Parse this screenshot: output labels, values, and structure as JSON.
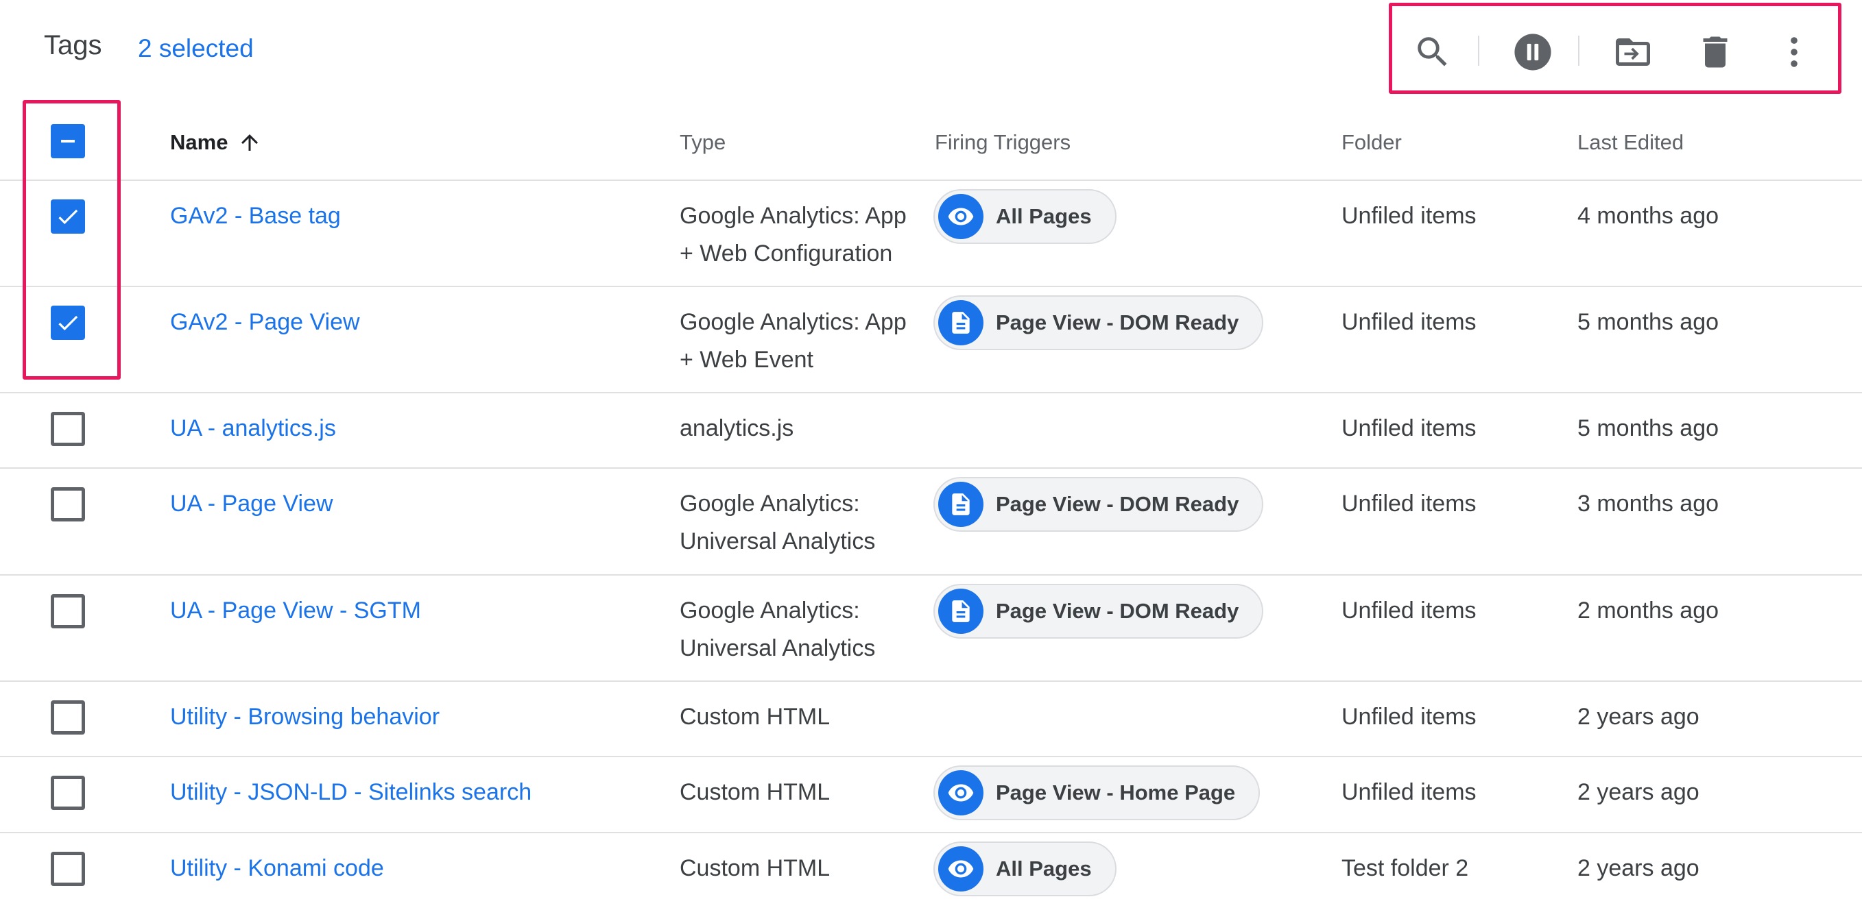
{
  "header": {
    "title": "Tags",
    "selected_label": "2 selected",
    "toolbar": [
      "search-icon",
      "pause-icon",
      "move-to-folder-icon",
      "delete-icon",
      "more-vert-icon"
    ]
  },
  "columns": {
    "name": "Name",
    "type": "Type",
    "triggers": "Firing Triggers",
    "folder": "Folder",
    "last_edited": "Last Edited"
  },
  "rows": [
    {
      "checked": true,
      "name": "GAv2 - Base tag",
      "type_line1": "Google Analytics: App",
      "type_line2": "+ Web Configuration",
      "trigger": "All Pages",
      "trigger_icon": "eye-icon",
      "folder": "Unfiled items",
      "last_edited": "4 months ago"
    },
    {
      "checked": true,
      "name": "GAv2 - Page View",
      "type_line1": "Google Analytics: App",
      "type_line2": "+ Web Event",
      "trigger": "Page View - DOM Ready",
      "trigger_icon": "document-icon",
      "folder": "Unfiled items",
      "last_edited": "5 months ago"
    },
    {
      "checked": false,
      "name": "UA - analytics.js",
      "type_line1": "analytics.js",
      "type_line2": "",
      "trigger": "",
      "trigger_icon": "",
      "folder": "Unfiled items",
      "last_edited": "5 months ago"
    },
    {
      "checked": false,
      "name": "UA - Page View",
      "type_line1": "Google Analytics:",
      "type_line2": "Universal Analytics",
      "trigger": "Page View - DOM Ready",
      "trigger_icon": "document-icon",
      "folder": "Unfiled items",
      "last_edited": "3 months ago"
    },
    {
      "checked": false,
      "name": "UA - Page View - SGTM",
      "type_line1": "Google Analytics:",
      "type_line2": "Universal Analytics",
      "trigger": "Page View - DOM Ready",
      "trigger_icon": "document-icon",
      "folder": "Unfiled items",
      "last_edited": "2 months ago"
    },
    {
      "checked": false,
      "name": "Utility - Browsing behavior",
      "type_line1": "Custom HTML",
      "type_line2": "",
      "trigger": "",
      "trigger_icon": "",
      "folder": "Unfiled items",
      "last_edited": "2 years ago"
    },
    {
      "checked": false,
      "name": "Utility - JSON-LD - Sitelinks search",
      "type_line1": "Custom HTML",
      "type_line2": "",
      "trigger": "Page View - Home Page",
      "trigger_icon": "eye-icon",
      "folder": "Unfiled items",
      "last_edited": "2 years ago"
    },
    {
      "checked": false,
      "name": "Utility - Konami code",
      "type_line1": "Custom HTML",
      "type_line2": "",
      "trigger": "All Pages",
      "trigger_icon": "eye-icon",
      "folder": "Test folder 2",
      "last_edited": "2 years ago"
    }
  ],
  "colors": {
    "accent": "#1a73e8",
    "highlight": "#e8175d",
    "icon": "#5f6368"
  }
}
